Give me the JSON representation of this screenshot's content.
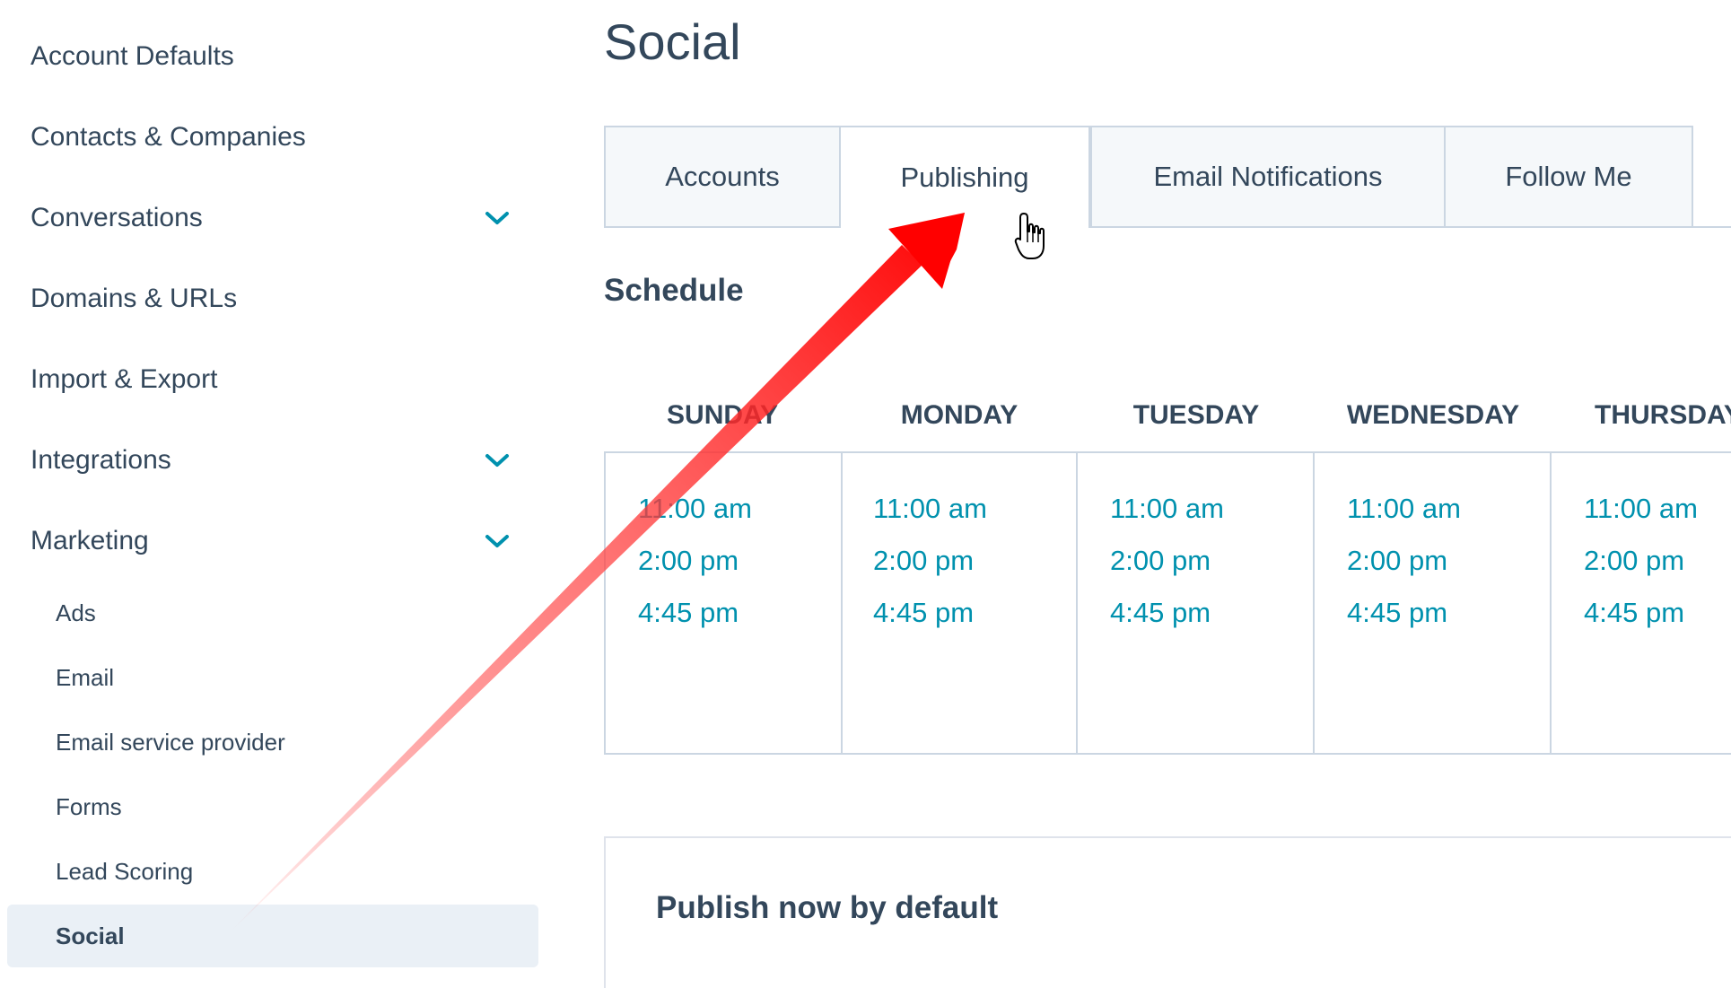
{
  "colors": {
    "text": "#33475b",
    "link": "#0091ae",
    "border": "#cbd6e2",
    "active_bg": "#eaf0f6",
    "tab_bg": "#f5f8fa",
    "arrow": "#ff0000"
  },
  "sidebar": {
    "items": [
      {
        "label": "Account Defaults",
        "expandable": false
      },
      {
        "label": "Contacts & Companies",
        "expandable": false
      },
      {
        "label": "Conversations",
        "expandable": true,
        "icon": "chevron-down-icon"
      },
      {
        "label": "Domains & URLs",
        "expandable": false
      },
      {
        "label": "Import & Export",
        "expandable": false
      },
      {
        "label": "Integrations",
        "expandable": true,
        "icon": "chevron-down-icon"
      },
      {
        "label": "Marketing",
        "expandable": true,
        "expanded": true,
        "icon": "chevron-down-icon"
      }
    ],
    "marketing_subitems": [
      {
        "label": "Ads"
      },
      {
        "label": "Email"
      },
      {
        "label": "Email service provider"
      },
      {
        "label": "Forms"
      },
      {
        "label": "Lead Scoring"
      },
      {
        "label": "Social",
        "active": true
      }
    ]
  },
  "main": {
    "title": "Social",
    "tabs": [
      {
        "label": "Accounts",
        "active": false
      },
      {
        "label": "Publishing",
        "active": true
      },
      {
        "label": "Email Notifications",
        "active": false
      },
      {
        "label": "Follow Me",
        "active": false
      }
    ],
    "schedule": {
      "heading": "Schedule",
      "days": [
        {
          "name": "SUNDAY",
          "times": [
            "11:00 am",
            "2:00 pm",
            "4:45 pm"
          ]
        },
        {
          "name": "MONDAY",
          "times": [
            "11:00 am",
            "2:00 pm",
            "4:45 pm"
          ]
        },
        {
          "name": "TUESDAY",
          "times": [
            "11:00 am",
            "2:00 pm",
            "4:45 pm"
          ]
        },
        {
          "name": "WEDNESDAY",
          "times": [
            "11:00 am",
            "2:00 pm",
            "4:45 pm"
          ]
        },
        {
          "name": "THURSDAY",
          "times": [
            "11:00 am",
            "2:00 pm",
            "4:45 pm"
          ]
        }
      ]
    },
    "publish_default": {
      "title": "Publish now by default"
    }
  },
  "annotation": {
    "arrow_icon": "arrow-icon",
    "cursor_icon": "hand-cursor-icon"
  }
}
